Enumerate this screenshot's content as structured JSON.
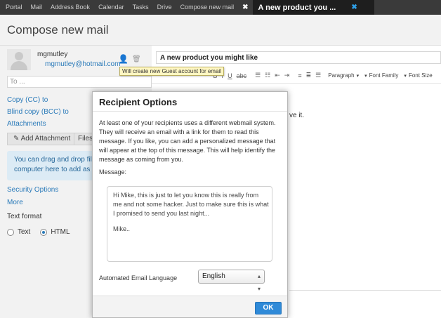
{
  "topbar": {
    "items": [
      "Portal",
      "Mail",
      "Address Book",
      "Calendar",
      "Tasks",
      "Drive",
      "Compose new mail"
    ],
    "active_tab": "A new product you ..."
  },
  "compose": {
    "title": "Compose new mail",
    "from_name": "mgmutley",
    "from_email": "mgmutley@hotmail.com",
    "to_placeholder": "To ...",
    "subject": "A new product you might like",
    "tooltip": "Will create new Guest account for email"
  },
  "sidebar": {
    "cc_link": "Copy (CC) to",
    "bcc_link": "Blind copy (BCC) to",
    "attachments_link": "Attachments",
    "add_attachment": "Add Attachment",
    "files": "Files",
    "drop_hint_line1": "You can drag and drop files",
    "drop_hint_line2": "computer here to add as at",
    "security_options": "Security Options",
    "more": "More",
    "text_format_label": "Text format",
    "format_text": "Text",
    "format_html": "HTML",
    "selected_format": "HTML"
  },
  "editor": {
    "paragraph": "Paragraph",
    "font_family": "Font Family",
    "font_size": "Font Size",
    "body_fragment": "ve it."
  },
  "dialog": {
    "title": "Recipient Options",
    "intro": "At least one of your recipients uses a different webmail system. They will receive an email with a link for them to read this message. If you like, you can add a personalized message that will appear at the top of this message. This will help identify the message as coming from you.",
    "message_label": "Message:",
    "message_body": "Hi Mike, this is just to let you know this is really from me and not some hacker. Just to make sure this is what I promised to send you last night...",
    "message_signoff": "Mike..",
    "language_label": "Automated Email Language",
    "language_value": "English",
    "ok": "OK"
  },
  "colors": {
    "accent_blue": "#2f8ad8",
    "link_blue": "#2a7ab9",
    "topbar": "#3a3a3a",
    "tooltip_bg": "#fff7c2"
  }
}
